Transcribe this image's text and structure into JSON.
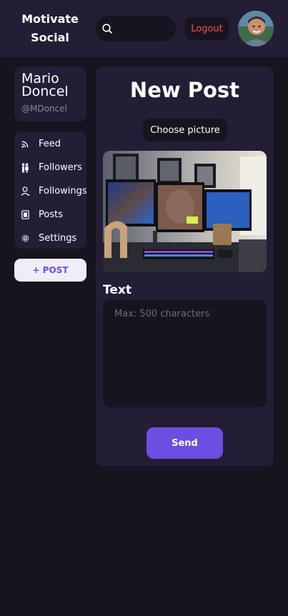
{
  "header": {
    "brand_line1": "Motivate",
    "brand_line2": "Social",
    "search_placeholder": "",
    "search_icon": "search-icon",
    "logout_label": "Logout",
    "avatar_icon": "user-avatar"
  },
  "profile": {
    "first_name": "Mario",
    "last_name": "Doncel",
    "handle": "@MDoncel"
  },
  "sidebar": {
    "items": [
      {
        "label": "Feed",
        "icon": "rss-icon"
      },
      {
        "label": "Followers",
        "icon": "followers-icon"
      },
      {
        "label": "Followings",
        "icon": "user-icon"
      },
      {
        "label": "Posts",
        "icon": "document-icon"
      },
      {
        "label": "Settings",
        "icon": "gear-icon"
      }
    ],
    "post_button": "+ POST"
  },
  "new_post": {
    "title": "New Post",
    "choose_picture": "Choose picture",
    "text_label": "Text",
    "text_placeholder": "Max: 500 characters",
    "send_label": "Send"
  },
  "colors": {
    "background": "#17141f",
    "panel": "#241d36",
    "accent": "#6b4fe0",
    "logout": "#ff4b5c"
  }
}
